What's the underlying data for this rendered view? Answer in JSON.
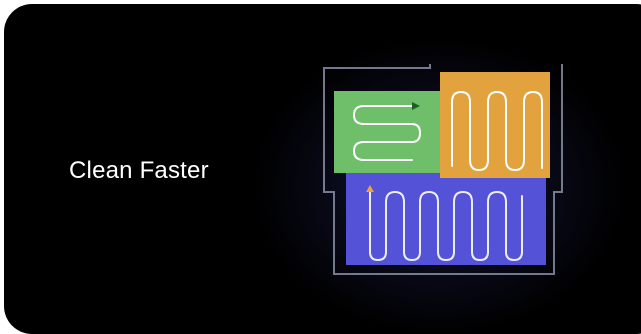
{
  "card": {
    "headline": "Clean Faster"
  },
  "colors": {
    "background": "#000000",
    "headline_text": "#ffffff",
    "zone_green": "#6fbf6a",
    "zone_orange": "#e2a23d",
    "zone_blue": "#5452d6",
    "path_line": "#ffffff",
    "outline": "#9aa0b8",
    "start_marker": "#1f5e26",
    "robot_marker": "#f0a23a"
  },
  "icons": {
    "map": "floor-map-illustration",
    "green_marker": "triangle-marker",
    "blue_marker": "arrow-up-marker"
  }
}
